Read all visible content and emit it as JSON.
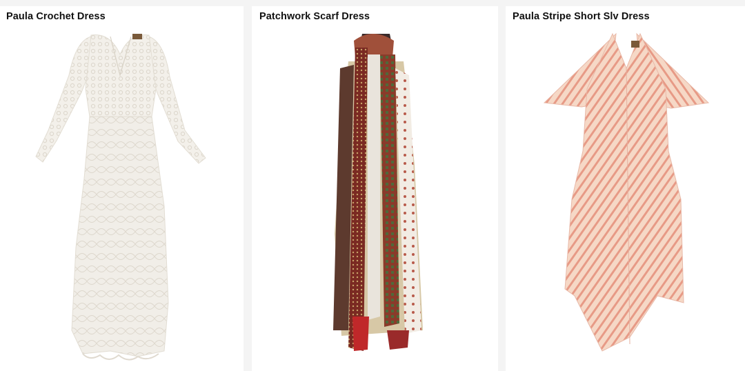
{
  "products": [
    {
      "name": "Paula Crochet Dress",
      "image": "white-crochet-long-sleeve-dress"
    },
    {
      "name": "Patchwork Scarf Dress",
      "image": "patchwork-scarf-dress"
    },
    {
      "name": "Paula Stripe Short Slv Dress",
      "image": "pink-stripe-short-sleeve-dress"
    }
  ]
}
